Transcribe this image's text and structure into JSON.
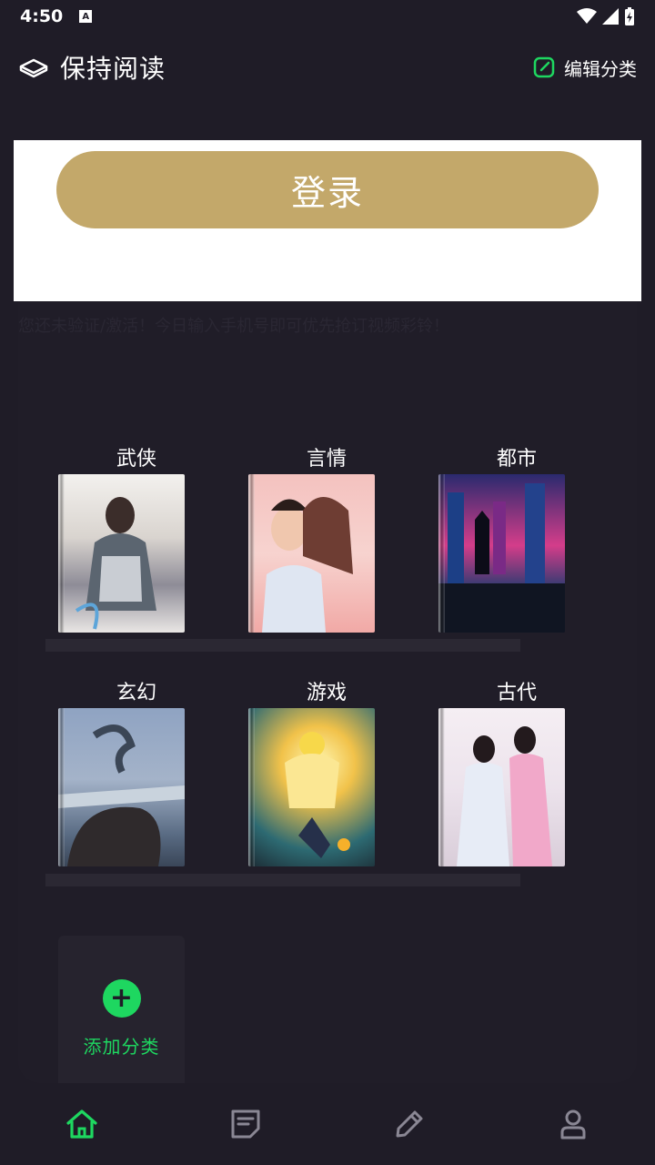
{
  "status": {
    "time": "4:50",
    "indicator": "A"
  },
  "header": {
    "title": "保持阅读",
    "edit_label": "编辑分类"
  },
  "login": {
    "label": "登录"
  },
  "marquee": {
    "text": "您还未验证/激活！今日输入手机号即可优先抢订视频彩铃！"
  },
  "categories": [
    {
      "label": "武侠"
    },
    {
      "label": "言情"
    },
    {
      "label": "都市"
    },
    {
      "label": "玄幻"
    },
    {
      "label": "游戏"
    },
    {
      "label": "古代"
    }
  ],
  "add_category": {
    "label": "添加分类",
    "icon": "+"
  },
  "nav": {
    "items": [
      "home-icon",
      "notes-icon",
      "pen-icon",
      "user-icon"
    ],
    "active_color": "#1ed760",
    "inactive_color": "#8a8794"
  },
  "colors": {
    "accent": "#1ed760",
    "login_gold": "#c3a86a",
    "background": "#1f1c27"
  }
}
